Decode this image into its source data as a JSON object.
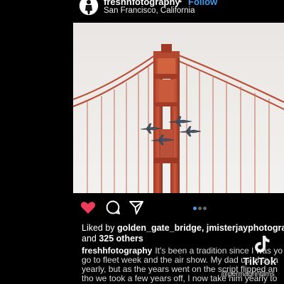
{
  "post": {
    "username": "freshhfotography",
    "separator": "•",
    "follow_label": "Follow",
    "location": "San Francisco, California",
    "carousel": {
      "count": 3,
      "active": 1
    }
  },
  "actions": {
    "like_icon": "heart-filled-icon",
    "comment_icon": "comment-icon",
    "share_icon": "send-icon",
    "like_color": "#ef3b5c"
  },
  "likes": {
    "prefix": "Liked by",
    "users": "golden_gate_bridge, jmisterjayphotograp",
    "conjunction": "and",
    "others": "325 others"
  },
  "caption": {
    "username": "freshhfotography",
    "text": "It's been a tradition since I was yo go to fleet week and the air show.  My dad used to ta yearly, but as the years went on the script flipped an tho we took a few years off, I now take him yearly to"
  },
  "watermark": {
    "brand": "TikTok",
    "handle": "@permagrintilms"
  }
}
